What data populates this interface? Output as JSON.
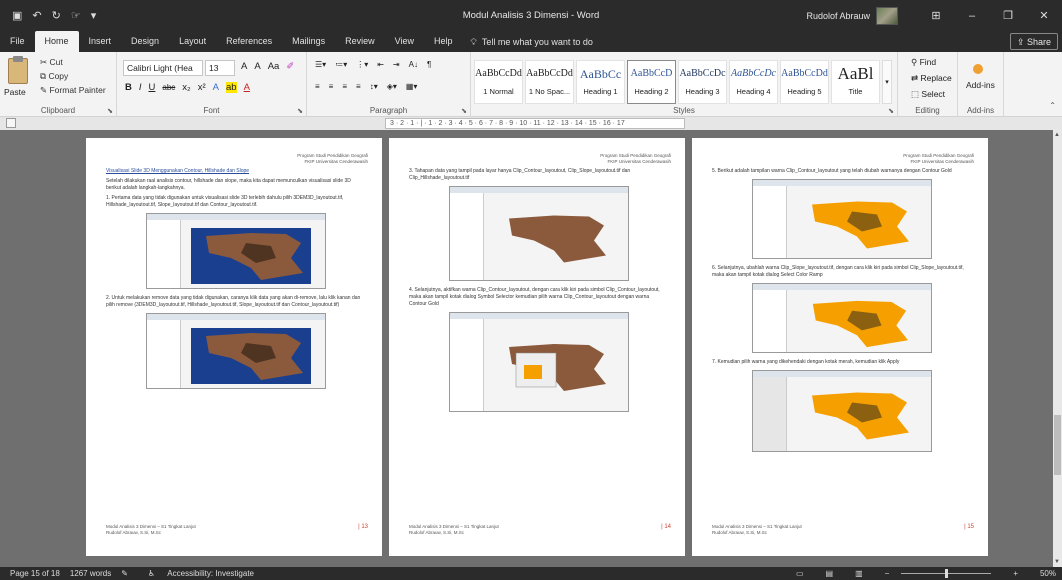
{
  "qat": {
    "save_icon": "save-icon",
    "undo_icon": "undo-icon",
    "redo_icon": "redo-icon",
    "touch_icon": "touch-mode-icon",
    "more_icon": "customize-qat-icon"
  },
  "window": {
    "title": "Modul Analisis 3 Dimensi  -  Word",
    "user": "Rudolof Abrauw",
    "min": "–",
    "restore": "❐",
    "close": "✕",
    "ribbon_toggle": "⊞"
  },
  "menu": {
    "tabs": [
      "File",
      "Home",
      "Insert",
      "Design",
      "Layout",
      "References",
      "Mailings",
      "Review",
      "View",
      "Help"
    ],
    "active": "Home",
    "tell_me": "Tell me what you want to do",
    "share": "Share"
  },
  "clipboard": {
    "paste": "Paste",
    "cut": "Cut",
    "copy": "Copy",
    "format_painter": "Format Painter",
    "label": "Clipboard"
  },
  "font": {
    "name": "Calibri Light (Hea",
    "size": "13",
    "grow": "A",
    "shrink": "A",
    "case": "Aa",
    "bold": "B",
    "italic": "I",
    "underline": "U",
    "strike": "abc",
    "sub": "x₂",
    "sup": "x²",
    "label": "Font"
  },
  "paragraph": {
    "label": "Paragraph"
  },
  "styles": {
    "label": "Styles",
    "items": [
      {
        "sample": "AaBbCcDd",
        "name": "1 Normal"
      },
      {
        "sample": "AaBbCcDd",
        "name": "1 No Spac..."
      },
      {
        "sample": "AaBbCc",
        "name": "Heading 1"
      },
      {
        "sample": "AaBbCcD",
        "name": "Heading 2"
      },
      {
        "sample": "AaBbCcDc",
        "name": "Heading 3"
      },
      {
        "sample": "AaBbCcDc",
        "name": "Heading 4"
      },
      {
        "sample": "AaBbCcDd",
        "name": "Heading 5"
      },
      {
        "sample": "AaBl",
        "name": "Title"
      }
    ]
  },
  "editing": {
    "find": "Find",
    "replace": "Replace",
    "select": "Select",
    "label": "Editing"
  },
  "addins": {
    "addins": "Add-ins",
    "label": "Add-ins"
  },
  "ruler": {
    "text": "3 · 2 · 1 · | · 1 · 2 · 3 · 4 · 5 · 6 · 7 · 8 · 9 · 10 · 11 · 12 · 13 · 14 · 15 · 16 · 17"
  },
  "pages": [
    {
      "header1": "Program Studi Pendidikan Geografi",
      "header2": "FKIP Universitas Cenderawasih",
      "heading": "Visualisasi Slide 3D Menggunakan Contour, Hillshade dan Slope",
      "intro": "Setelah dilakukan raal analisis contour, hillshade dan slope, maka kita dapat memunculkan visualisasi slide 3D berikut adalah langkah-langkahnya.",
      "step1": "1.  Pertama data yang tidak digunakan untuk visualisasi slide 3D terlebih dahulu pilih 3DEM3D_layoutout.tif, Hillshade_layoutout.tif, Slope_layoutout.tif dan Contour_layoutout.tif.",
      "step2": "2.  Untuk melakukan remove data yang tidak digunakan, caranya klik data yang akan di-remove, lalu klik kanan dan pilih remove (3DEM3D_layoutout.tif, Hillshade_layoutout.tif, Slope_layoutout.tif dan Contour_layoutout.tif)",
      "footer1": "Modul Analisis 3 Dimensi – S1 Tingkat Lanjut",
      "footer2": "Rudolof Abrauw, S.Si, M.Sc",
      "num": "| 13"
    },
    {
      "header1": "Program Studi Pendidikan Geografi",
      "header2": "FKIP Universitas Cenderawasih",
      "step3": "3.  Tahapan data yang tampil pada layar hanya Clip_Contour_layoutout, Clip_Slope_layoutout.tif dan Clip_Hillshade_layoutout.tif",
      "step4": "4.  Selanjutnya, aktifkan warna Clip_Contour_layoutout, dengan cara klik kiri pada simbol Clip_Contour_layoutout, maka akan tampil kotak dialog Symbol Selector kemudian pilih warna Clip_Contour_layoutout dengan warna Contour Gold",
      "footer1": "Modul Analisis 3 Dimensi – S1 Tingkat Lanjut",
      "footer2": "Rudolof Abrauw, S.Si, M.Sc",
      "num": "| 14"
    },
    {
      "header1": "Program Studi Pendidikan Geografi",
      "header2": "FKIP Universitas Cenderawasih",
      "step5": "5.  Berikut adalah tampilan warna Clip_Contour_layoutout yang telah diubah warnanya dengan Contour Gold",
      "step6": "6.  Selanjutnya, ubahlah warna Clip_Slope_layoutout.tif, dengan cara klik kiri pada simbol Clip_Slope_layoutout.tif, maka akan tampil kotak dialog Select Color Ramp",
      "step7": "7.  Kemudian pilih warna yang dikehendaki dengan kotak merah, kemudian klik Apply",
      "footer1": "Modul Analisis 3 Dimensi – S1 Tingkat Lanjut",
      "footer2": "Rudolof Abrauw, S.Si, M.Sc",
      "num": "| 15"
    }
  ],
  "status": {
    "page": "Page 15 of 18",
    "words": "1267 words",
    "accessibility": "Accessibility: Investigate",
    "zoom": "50%"
  },
  "colors": {
    "brown": "#8b5a3c",
    "orange": "#f5a000",
    "blue": "#1b3f8f"
  }
}
